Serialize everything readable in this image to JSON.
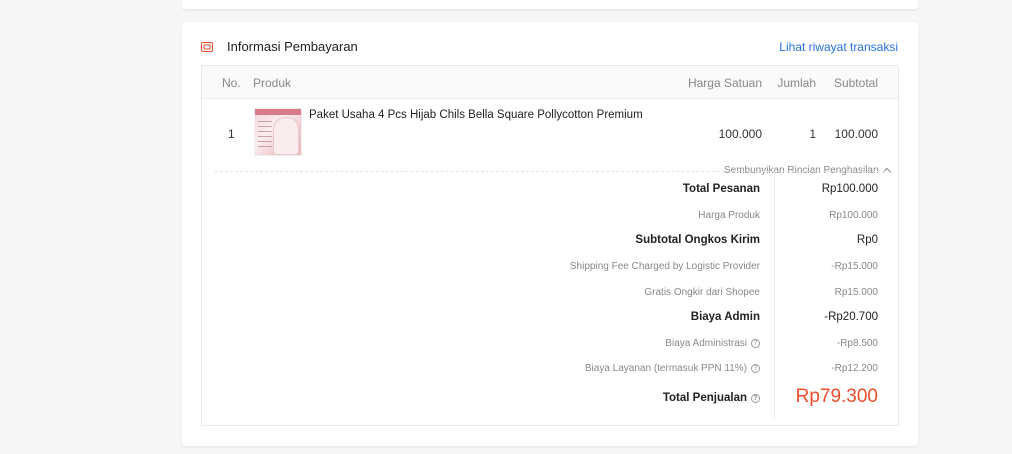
{
  "colors": {
    "accent": "#ee4d2d",
    "link": "#2673dd"
  },
  "section": {
    "icon": "payment-card-icon",
    "title": "Informasi Pembayaran",
    "history_link": "Lihat riwayat transaksi"
  },
  "table": {
    "headers": {
      "no": "No.",
      "product": "Produk",
      "unit_price": "Harga Satuan",
      "qty": "Jumlah",
      "subtotal": "Subtotal"
    },
    "rows": [
      {
        "no": "1",
        "product": "Paket Usaha 4 Pcs Hijab Chils Bella Square Pollycotton Premium",
        "unit_price": "100.000",
        "qty": "1",
        "subtotal": "100.000"
      }
    ]
  },
  "details": {
    "toggle_label": "Sembunyikan Rincian Penghasilan",
    "rows": [
      {
        "label": "Total Pesanan",
        "value": "Rp100.000"
      },
      {
        "label": "Harga Produk",
        "value": "Rp100.000"
      },
      {
        "label": "Subtotal Ongkos Kirim",
        "value": "Rp0"
      },
      {
        "label": "Shipping Fee Charged by Logistic Provider",
        "value": "-Rp15.000"
      },
      {
        "label": "Gratis Ongkir dari Shopee",
        "value": "Rp15.000"
      },
      {
        "label": "Biaya Admin",
        "value": "-Rp20.700"
      },
      {
        "label": "Biaya Administrasi",
        "value": "-Rp8.500"
      },
      {
        "label": "Biaya Layanan (termasuk PPN 11%)",
        "value": "-Rp12.200"
      }
    ],
    "total": {
      "label": "Total Penjualan",
      "value": "Rp79.300"
    }
  }
}
